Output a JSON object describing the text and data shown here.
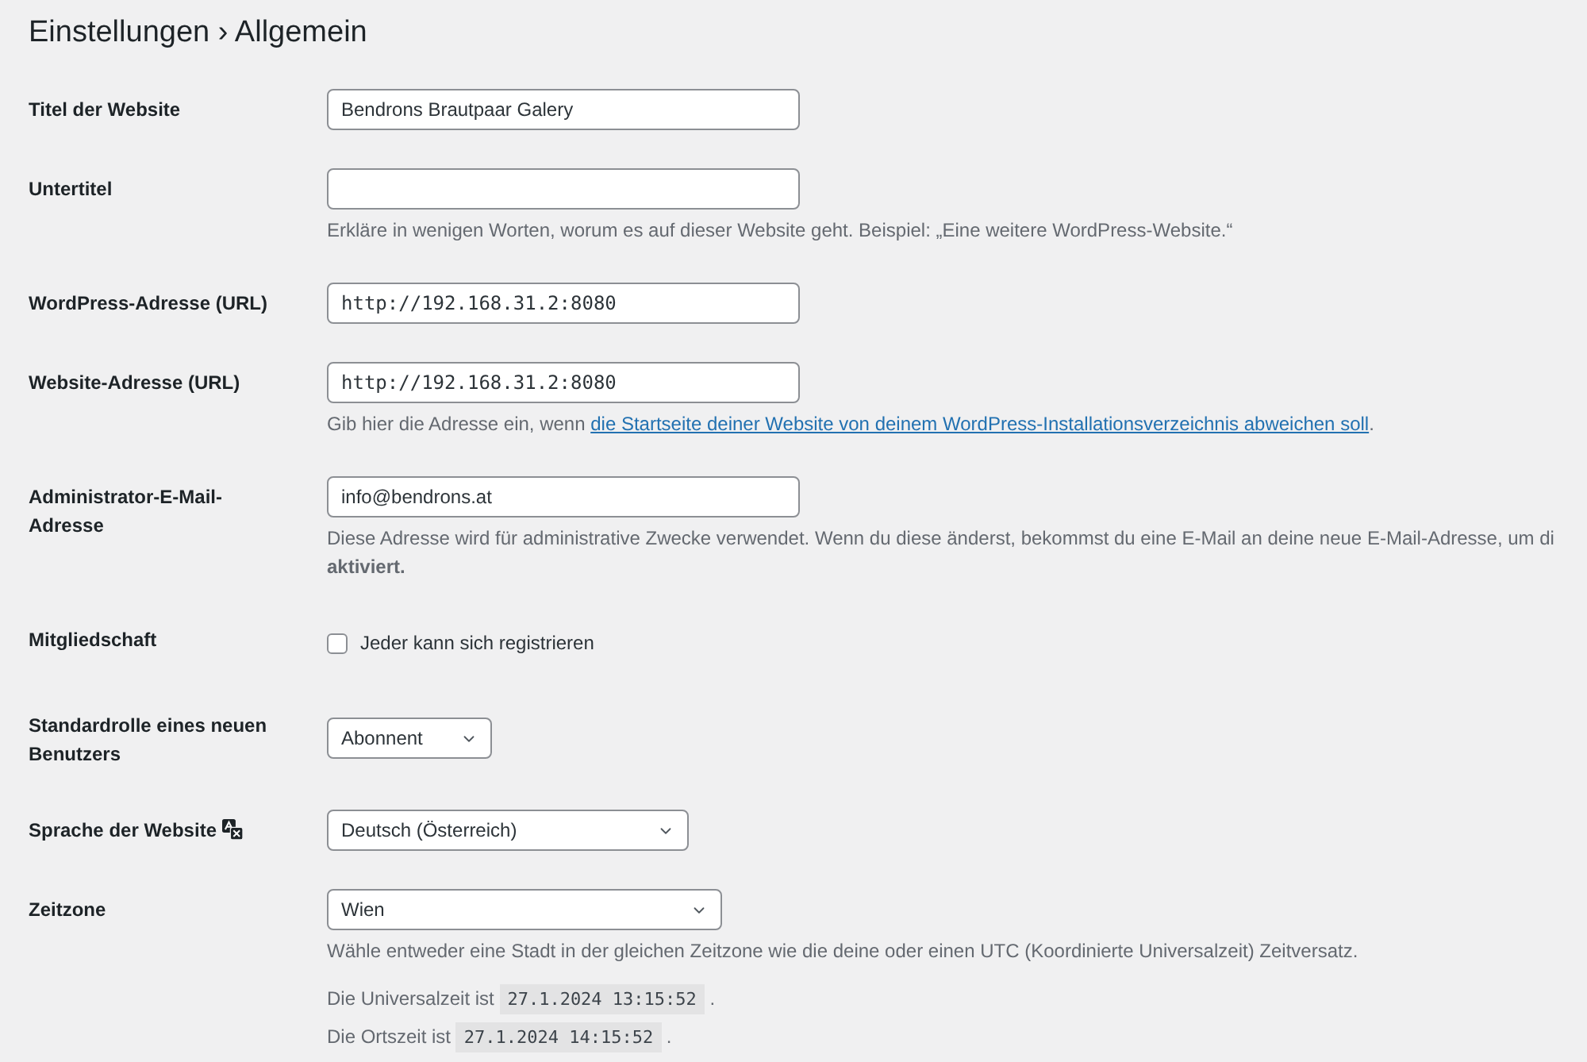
{
  "page": {
    "title": "Einstellungen › Allgemein"
  },
  "settings": [
    {
      "kind": "text",
      "label": "Titel der Website",
      "value": "Bendrons Brautpaar Galery"
    },
    {
      "kind": "text",
      "label": "Untertitel",
      "description": [
        {
          "kind": "text",
          "text": "Erkläre in wenigen Worten, worum es auf dieser Website geht. Beispiel: „Eine weitere WordPress-Website.“"
        }
      ]
    },
    {
      "kind": "url",
      "label": "WordPress-Adresse (URL)",
      "value": "http://192.168.31.2:8080"
    },
    {
      "kind": "url",
      "label": "Website-Adresse (URL)",
      "value": "http://192.168.31.2:8080",
      "description": [
        {
          "kind": "text",
          "text": "Gib hier die Adresse ein, wenn "
        },
        {
          "kind": "link",
          "text": "die Startseite deiner Website von deinem WordPress-Installationsverzeichnis abweichen soll"
        },
        {
          "kind": "text",
          "text": "."
        }
      ]
    },
    {
      "kind": "text",
      "label": "Administrator-E-Mail-Adresse",
      "value": "info@bendrons.at",
      "description": [
        {
          "kind": "text",
          "text": "Diese Adresse wird für administrative Zwecke verwendet. Wenn du diese änderst, bekommst du eine E-Mail an deine neue E-Mail-Adresse, um di\n**aktiviert.**"
        }
      ]
    },
    {
      "kind": "checkbox",
      "label": "Mitgliedschaft",
      "option": "Jeder kann sich registrieren",
      "checked": false
    },
    {
      "kind": "select",
      "label": "Standardrolle eines neuen Benutzers",
      "value": "Abonnent"
    },
    {
      "kind": "language",
      "label": "Sprache der Website",
      "value": "Deutsch (Österreich)"
    },
    {
      "kind": "timezone",
      "label": "Zeitzone",
      "value": "Wien",
      "description": [
        {
          "kind": "text",
          "text": "Wähle entweder eine Stadt in der gleichen Zeitzone wie die deine oder einen UTC (Koordinierte Universalzeit) Zeitversatz."
        }
      ],
      "time_info": [
        {
          "label": "Die Universalzeit ist",
          "time": "27.1.2024 13:15:52",
          "after": "."
        },
        {
          "label": "Die Ortszeit ist",
          "time": "27.1.2024 14:15:52",
          "after": "."
        }
      ]
    }
  ]
}
